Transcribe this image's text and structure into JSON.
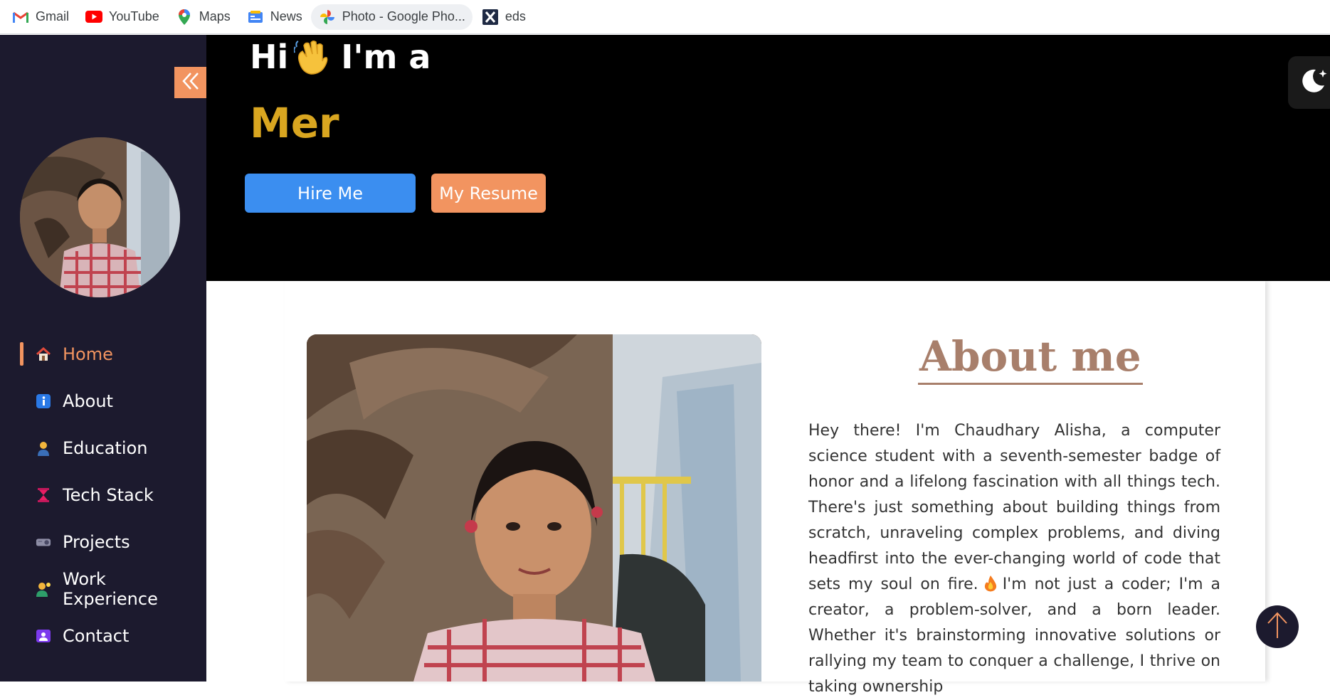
{
  "bookmarks": [
    {
      "label": "Gmail",
      "icon": "gmail-icon"
    },
    {
      "label": "YouTube",
      "icon": "youtube-icon"
    },
    {
      "label": "Maps",
      "icon": "maps-icon"
    },
    {
      "label": "News",
      "icon": "news-icon"
    },
    {
      "label": "Photo - Google Pho...",
      "icon": "google-photos-icon"
    },
    {
      "label": "eds",
      "icon": "x-icon"
    }
  ],
  "sidebar": {
    "collapse_icon": "double-chevron-left-icon",
    "items": [
      {
        "label": "Home",
        "icon": "house-icon",
        "active": true
      },
      {
        "label": "About",
        "icon": "info-icon"
      },
      {
        "label": "Education",
        "icon": "student-icon"
      },
      {
        "label": "Tech Stack",
        "icon": "hourglass-icon"
      },
      {
        "label": "Projects",
        "icon": "projector-icon"
      },
      {
        "label": "Work Experience",
        "icon": "technologist-icon"
      },
      {
        "label": "Contact",
        "icon": "contact-card-icon"
      }
    ]
  },
  "hero": {
    "greeting_start": "Hi",
    "greeting_end": "I'm a",
    "typed_text": "Mer",
    "hire_label": "Hire Me",
    "resume_label": "My Resume",
    "theme_icon": "moon-stars-icon"
  },
  "about": {
    "title": "About me",
    "text_before_emoji": "Hey there! I'm Chaudhary Alisha, a computer science student with a seventh-semester badge of honor and a lifelong fascination with all things tech. There's just something about building things from scratch, unraveling complex problems, and diving headfirst into the ever-changing world of code that sets my soul on fire.",
    "text_after_emoji": "I'm not just a coder; I'm a creator, a problem-solver, and a born leader. Whether it's brainstorming innovative solutions or rallying my team to conquer a challenge, I thrive on taking ownership"
  },
  "colors": {
    "accent": "#f29460",
    "primary_button": "#3b8ef0",
    "typed_text": "#d9a620",
    "sidebar_bg": "#1c1a2e",
    "about_title": "#a87f6b"
  }
}
